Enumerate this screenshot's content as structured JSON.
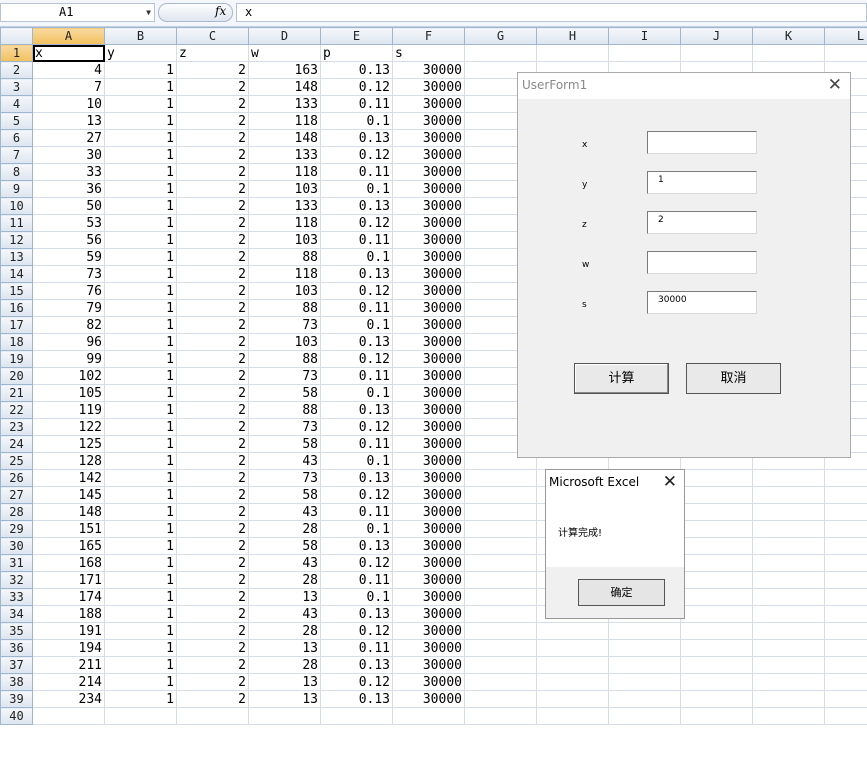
{
  "formula_bar": {
    "name_box": "A1",
    "fx": "fx",
    "content": "x"
  },
  "grid": {
    "columns": [
      "A",
      "B",
      "C",
      "D",
      "E",
      "F",
      "G",
      "H",
      "I",
      "J",
      "K",
      "L"
    ],
    "header_row": [
      "x",
      "y",
      "z",
      "w",
      "p",
      "s"
    ],
    "rows": [
      [
        "4",
        "1",
        "2",
        "163",
        "0.13",
        "30000"
      ],
      [
        "7",
        "1",
        "2",
        "148",
        "0.12",
        "30000"
      ],
      [
        "10",
        "1",
        "2",
        "133",
        "0.11",
        "30000"
      ],
      [
        "13",
        "1",
        "2",
        "118",
        "0.1",
        "30000"
      ],
      [
        "27",
        "1",
        "2",
        "148",
        "0.13",
        "30000"
      ],
      [
        "30",
        "1",
        "2",
        "133",
        "0.12",
        "30000"
      ],
      [
        "33",
        "1",
        "2",
        "118",
        "0.11",
        "30000"
      ],
      [
        "36",
        "1",
        "2",
        "103",
        "0.1",
        "30000"
      ],
      [
        "50",
        "1",
        "2",
        "133",
        "0.13",
        "30000"
      ],
      [
        "53",
        "1",
        "2",
        "118",
        "0.12",
        "30000"
      ],
      [
        "56",
        "1",
        "2",
        "103",
        "0.11",
        "30000"
      ],
      [
        "59",
        "1",
        "2",
        "88",
        "0.1",
        "30000"
      ],
      [
        "73",
        "1",
        "2",
        "118",
        "0.13",
        "30000"
      ],
      [
        "76",
        "1",
        "2",
        "103",
        "0.12",
        "30000"
      ],
      [
        "79",
        "1",
        "2",
        "88",
        "0.11",
        "30000"
      ],
      [
        "82",
        "1",
        "2",
        "73",
        "0.1",
        "30000"
      ],
      [
        "96",
        "1",
        "2",
        "103",
        "0.13",
        "30000"
      ],
      [
        "99",
        "1",
        "2",
        "88",
        "0.12",
        "30000"
      ],
      [
        "102",
        "1",
        "2",
        "73",
        "0.11",
        "30000"
      ],
      [
        "105",
        "1",
        "2",
        "58",
        "0.1",
        "30000"
      ],
      [
        "119",
        "1",
        "2",
        "88",
        "0.13",
        "30000"
      ],
      [
        "122",
        "1",
        "2",
        "73",
        "0.12",
        "30000"
      ],
      [
        "125",
        "1",
        "2",
        "58",
        "0.11",
        "30000"
      ],
      [
        "128",
        "1",
        "2",
        "43",
        "0.1",
        "30000"
      ],
      [
        "142",
        "1",
        "2",
        "73",
        "0.13",
        "30000"
      ],
      [
        "145",
        "1",
        "2",
        "58",
        "0.12",
        "30000"
      ],
      [
        "148",
        "1",
        "2",
        "43",
        "0.11",
        "30000"
      ],
      [
        "151",
        "1",
        "2",
        "28",
        "0.1",
        "30000"
      ],
      [
        "165",
        "1",
        "2",
        "58",
        "0.13",
        "30000"
      ],
      [
        "168",
        "1",
        "2",
        "43",
        "0.12",
        "30000"
      ],
      [
        "171",
        "1",
        "2",
        "28",
        "0.11",
        "30000"
      ],
      [
        "174",
        "1",
        "2",
        "13",
        "0.1",
        "30000"
      ],
      [
        "188",
        "1",
        "2",
        "43",
        "0.13",
        "30000"
      ],
      [
        "191",
        "1",
        "2",
        "28",
        "0.12",
        "30000"
      ],
      [
        "194",
        "1",
        "2",
        "13",
        "0.11",
        "30000"
      ],
      [
        "211",
        "1",
        "2",
        "28",
        "0.13",
        "30000"
      ],
      [
        "214",
        "1",
        "2",
        "13",
        "0.12",
        "30000"
      ],
      [
        "234",
        "1",
        "2",
        "13",
        "0.13",
        "30000"
      ]
    ],
    "last_row_number": "40"
  },
  "userform": {
    "title": "UserForm1",
    "fields": [
      {
        "label": "x",
        "value": ""
      },
      {
        "label": "y",
        "value": "1"
      },
      {
        "label": "z",
        "value": "2"
      },
      {
        "label": "w",
        "value": ""
      },
      {
        "label": "s",
        "value": "30000"
      }
    ],
    "calc_label": "计算",
    "cancel_label": "取消"
  },
  "msgbox": {
    "title": "Microsoft Excel",
    "message": "计算完成!",
    "ok_label": "确定"
  },
  "colors": {
    "selected_header": "#f1c15f",
    "grid_line": "#d6dde8"
  }
}
